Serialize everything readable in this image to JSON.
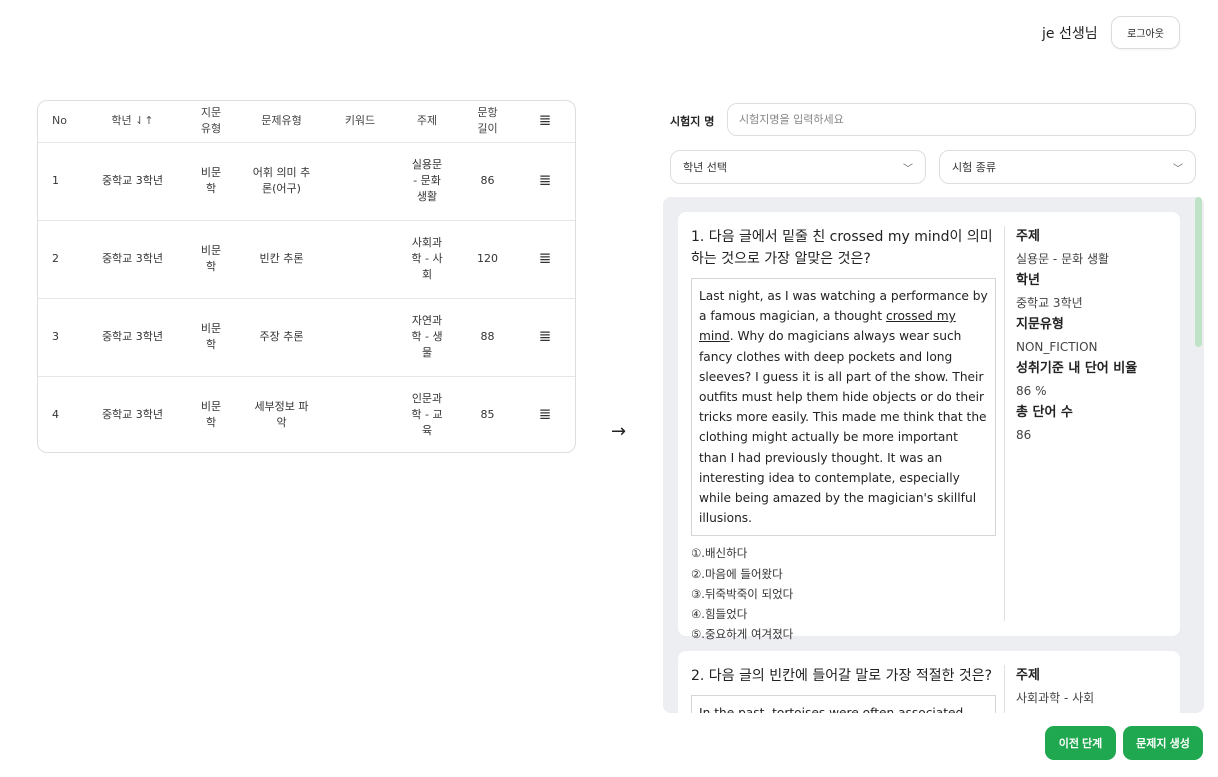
{
  "header": {
    "user_name": "je 선생님",
    "logout_label": "로그아웃"
  },
  "table": {
    "columns": [
      "No",
      "학년",
      "지문\n유형",
      "문제유형",
      "키워드",
      "주제",
      "문항\n길이"
    ],
    "sort_icon": "⇃↑",
    "menu_icon": "≣",
    "rows": [
      {
        "no": "1",
        "grade": "중학교 3학년",
        "passage_type": "비문\n학",
        "question_type": "어휘 의미 추\n론(어구)",
        "keyword": "",
        "topic": "실용문\n- 문화\n생활",
        "length": "86"
      },
      {
        "no": "2",
        "grade": "중학교 3학년",
        "passage_type": "비문\n학",
        "question_type": "빈칸 추론",
        "keyword": "",
        "topic": "사회과\n학 - 사\n회",
        "length": "120"
      },
      {
        "no": "3",
        "grade": "중학교 3학년",
        "passage_type": "비문\n학",
        "question_type": "주장 추론",
        "keyword": "",
        "topic": "자연과\n학 - 생\n물",
        "length": "88"
      },
      {
        "no": "4",
        "grade": "중학교 3학년",
        "passage_type": "비문\n학",
        "question_type": "세부정보 파\n악",
        "keyword": "",
        "topic": "인문과\n학 - 교\n육",
        "length": "85"
      }
    ]
  },
  "arrow": "→",
  "form": {
    "exam_name_label": "시험지 명",
    "exam_name_placeholder": "시험지명을 입력하세요",
    "grade_select": "학년 선택",
    "exam_type_select": "시험 종류",
    "chevron_icon": "chevron-down-icon"
  },
  "preview": {
    "questions": [
      {
        "title": "1. 다음 글에서 밑줄 친 crossed my mind이 의미하는 것으로 가장 알맞은 것은?",
        "passage_before": "Last night, as I was watching a performance by a famous magician, a thought ",
        "passage_underline": "crossed my mind",
        "passage_after": ". Why do magicians always wear such fancy clothes with deep pockets and long sleeves? I guess it is all part of the show. Their outfits must help them hide objects or do their tricks more easily. This made me think that the clothing might actually be more important than I had previously thought. It was an interesting idea to contemplate, especially while being amazed by the magician's skillful illusions.",
        "options": [
          "①.배신하다",
          "②.마음에 들어왔다",
          "③.뒤죽박죽이 되었다",
          "④.힘들었다",
          "⑤.중요하게 여겨졌다"
        ],
        "meta": {
          "topic_label": "주제",
          "topic": "실용문 - 문화 생활",
          "grade_label": "학년",
          "grade": "중학교 3학년",
          "passage_type_label": "지문유형",
          "passage_type": "NON_FICTION",
          "ratio_label": "성취기준 내 단어 비율",
          "ratio": "86 %",
          "word_count_label": "총 단어 수",
          "word_count": "86"
        }
      },
      {
        "title": "2. 다음 글의 빈칸에 들어갈 말로 가장 적절한 것은?",
        "passage": "In the past, tortoises were often associated",
        "meta": {
          "topic_label": "주제",
          "topic": "사회과학 - 사회"
        }
      }
    ]
  },
  "footer": {
    "prev_label": "이전 단계",
    "create_label": "문제지 생성"
  }
}
